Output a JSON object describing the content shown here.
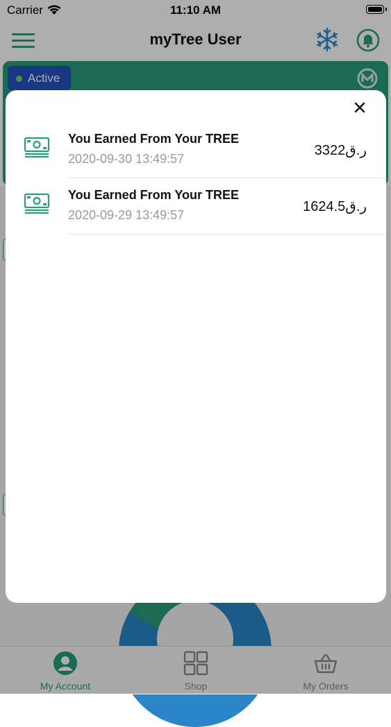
{
  "status_bar": {
    "carrier": "Carrier",
    "time": "11:10 AM"
  },
  "header": {
    "title": "myTree User",
    "icons": [
      "menu-icon",
      "snowflake-icon",
      "bell-icon"
    ]
  },
  "banner": {
    "status_label": "Active"
  },
  "modal": {
    "close_icon": "close-icon",
    "transactions": [
      {
        "title": "You Earned From Your TREE",
        "date": "2020-09-30 13:49:57",
        "amount": "3322ر.ق",
        "icon": "money-icon"
      },
      {
        "title": "You Earned From Your TREE",
        "date": "2020-09-29 13:49:57",
        "amount": "1624.5ر.ق",
        "icon": "money-icon"
      }
    ]
  },
  "tab_bar": {
    "tabs": [
      {
        "label": "My Account",
        "icon": "user-icon",
        "active": true
      },
      {
        "label": "Shop",
        "icon": "grid-icon",
        "active": false
      },
      {
        "label": "My Orders",
        "icon": "basket-icon",
        "active": false
      }
    ]
  },
  "colors": {
    "accent": "#2a9c7d",
    "status_active": "#2453c2",
    "overlay": "rgba(0,0,0,0.32)"
  }
}
